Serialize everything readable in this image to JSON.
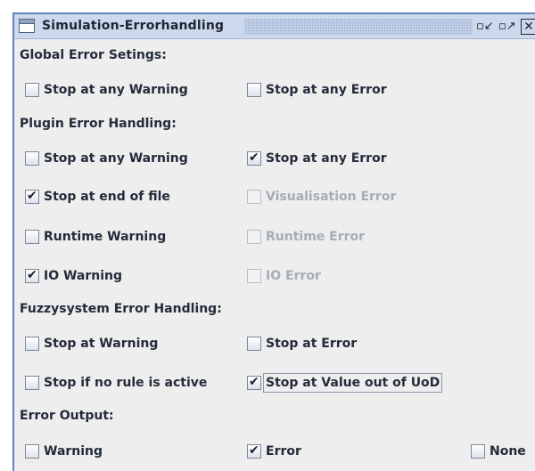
{
  "window": {
    "title": "Simulation-Errorhandling",
    "icons": {
      "app": "window-icon",
      "minimize": "minimize-icon",
      "maximize": "maximize-icon",
      "close": "close-icon"
    },
    "glyphs": {
      "minimize": "▫↙",
      "maximize": "▫↗",
      "close": "✕"
    }
  },
  "sections": {
    "global": {
      "title": "Global Error Setings:",
      "warning": {
        "label": "Stop at any Warning",
        "checked": false
      },
      "error": {
        "label": "Stop at any Error",
        "checked": false
      }
    },
    "plugin": {
      "title": "Plugin Error Handling:",
      "warning": {
        "label": "Stop at any Warning",
        "checked": false
      },
      "error": {
        "label": "Stop at any Error",
        "checked": true
      },
      "end_of_file": {
        "label": "Stop at end of file",
        "checked": true
      },
      "visualisation": {
        "label": "Visualisation Error",
        "checked": false,
        "disabled": true
      },
      "runtime_warning": {
        "label": "Runtime Warning",
        "checked": false
      },
      "runtime_error": {
        "label": "Runtime Error",
        "checked": false,
        "disabled": true
      },
      "io_warning": {
        "label": "IO Warning",
        "checked": true
      },
      "io_error": {
        "label": "IO Error",
        "checked": false,
        "disabled": true
      }
    },
    "fuzzy": {
      "title": "Fuzzysystem Error Handling:",
      "warning": {
        "label": "Stop at Warning",
        "checked": false
      },
      "error": {
        "label": "Stop at Error",
        "checked": false
      },
      "no_rule": {
        "label": "Stop if no rule is active",
        "checked": false
      },
      "out_of_uod": {
        "label": "Stop at Value out of UoD",
        "checked": true
      }
    },
    "output": {
      "title": "Error Output:",
      "warning": {
        "label": "Warning",
        "checked": false
      },
      "error": {
        "label": "Error",
        "checked": true
      },
      "none": {
        "label": "None",
        "checked": false
      }
    }
  },
  "colors": {
    "window_border": "#6382bf",
    "titlebar": "#ccd8ec",
    "panel": "#eeeeee",
    "text": "#232b3a",
    "disabled_text": "#a7adb6"
  }
}
